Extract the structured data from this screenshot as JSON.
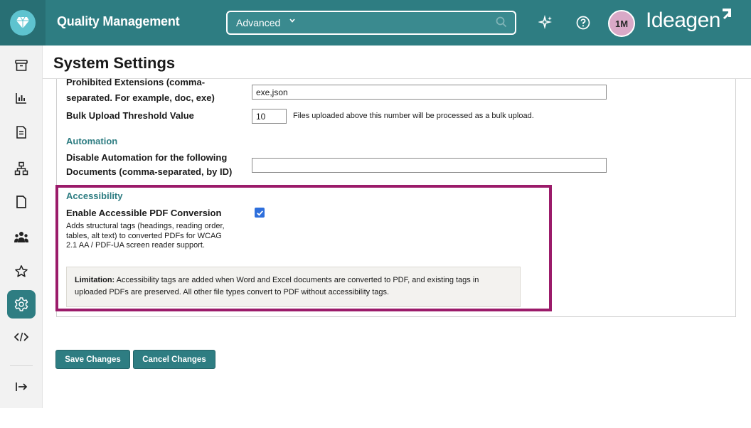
{
  "header": {
    "app_title": "Quality Management",
    "search_scope": "Advanced",
    "avatar_initials": "1M",
    "brand": "Ideagen",
    "accent_color": "#2e7d82"
  },
  "sidebar": {
    "items": [
      {
        "icon": "archive-icon"
      },
      {
        "icon": "bar-chart-icon"
      },
      {
        "icon": "document-icon"
      },
      {
        "icon": "org-chart-icon"
      },
      {
        "icon": "file-icon"
      },
      {
        "icon": "people-icon"
      },
      {
        "icon": "star-icon"
      },
      {
        "icon": "gear-icon",
        "active": true
      },
      {
        "icon": "code-icon"
      },
      {
        "icon": "expand-icon"
      }
    ]
  },
  "page": {
    "title": "System Settings"
  },
  "settings": {
    "prohibited_label_1": "Prohibited Extensions (comma-",
    "prohibited_label_2": "separated. For example, doc, exe)",
    "prohibited_value": "exe,json",
    "bulk_label": "Bulk Upload Threshold Value",
    "bulk_value": "10",
    "bulk_hint": "Files uploaded above this number will be processed as a bulk upload.",
    "automation_heading": "Automation",
    "automation_label_1": "Disable Automation for the following",
    "automation_label_2": "Documents (comma-separated, by ID)",
    "automation_value": "",
    "accessibility_heading": "Accessibility",
    "accessible_pdf_label": "Enable Accessible PDF Conversion",
    "accessible_pdf_checked": true,
    "accessible_pdf_desc": "Adds structural tags (headings, reading order, tables, alt text) to converted PDFs for WCAG 2.1 AA / PDF-UA screen reader support.",
    "limitation_title": "Limitation:",
    "limitation_text": " Accessibility tags are added when Word and Excel documents are converted to PDF, and existing tags in uploaded PDFs are preserved. All other file types convert to PDF without accessibility tags."
  },
  "actions": {
    "save_label": "Save Changes",
    "cancel_label": "Cancel Changes"
  }
}
